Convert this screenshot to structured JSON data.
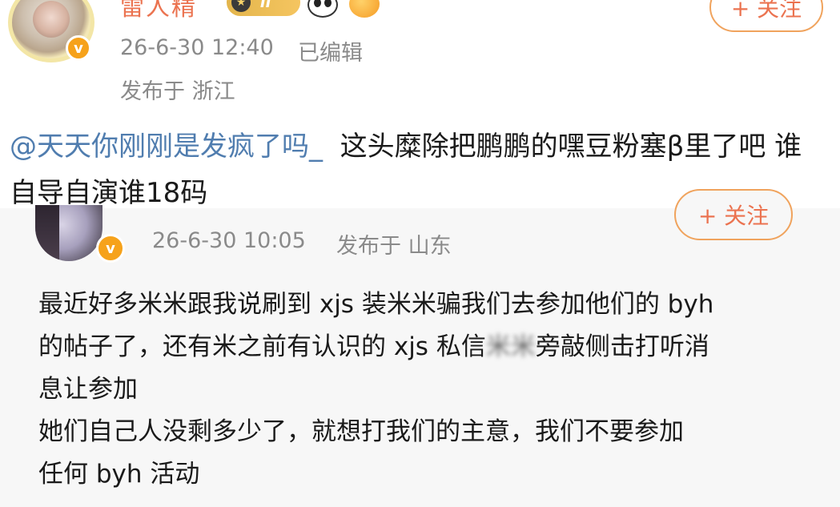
{
  "post": {
    "username": "雷人精",
    "level_label": "II",
    "time": "26-6-30 12:40",
    "edited_label": "已编辑",
    "location": "发布于 浙江",
    "follow_label": "+ 关注"
  },
  "comment": {
    "mention": "@天天你刚刚是发疯了吗_",
    "text": "这头糜除把鹏鹏的嘿豆粉塞β里了吧 谁自导自演谁18码"
  },
  "quote": {
    "time": "26-6-30 10:05",
    "location": "发布于 山东",
    "follow_label": "+ 关注",
    "lines": {
      "l1": "最近好多米米跟我说刷到 xjs 装米米骗我们去参加他们的 byh",
      "l2a": "的帖子了，还有米之前有认识的 xjs 私信",
      "l2blur": "米米",
      "l2b": "旁敲侧击打听消",
      "l3": "息让参加",
      "l4": "她们自己人没剩多少了，就想打我们的主意，我们不要参加",
      "l5": "任何 byh 活动"
    }
  },
  "colors": {
    "username": "#eb7350",
    "mention": "#507daf",
    "meta": "#8a8a8a",
    "verified_badge": "#f6a21b",
    "quote_bg": "#f7f7f7"
  }
}
